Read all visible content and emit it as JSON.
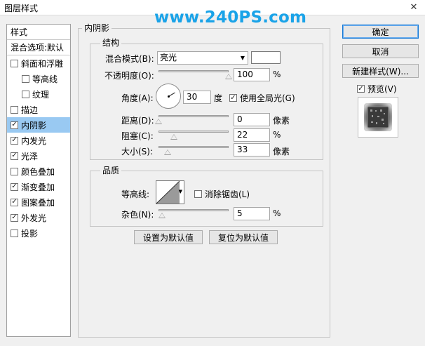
{
  "window": {
    "title": "图层样式",
    "close_glyph": "✕"
  },
  "watermark": "www.240PS.com",
  "sidebar": {
    "header_style": "样式",
    "header_blend": "混合选项:默认",
    "items": [
      {
        "label": "斜面和浮雕",
        "checked": false
      },
      {
        "label": "等高线",
        "checked": false,
        "indent": true
      },
      {
        "label": "纹理",
        "checked": false,
        "indent": true
      },
      {
        "label": "描边",
        "checked": false
      },
      {
        "label": "内阴影",
        "checked": true,
        "active": true
      },
      {
        "label": "内发光",
        "checked": true
      },
      {
        "label": "光泽",
        "checked": true
      },
      {
        "label": "颜色叠加",
        "checked": false
      },
      {
        "label": "渐变叠加",
        "checked": true
      },
      {
        "label": "图案叠加",
        "checked": true
      },
      {
        "label": "外发光",
        "checked": true
      },
      {
        "label": "投影",
        "checked": false
      }
    ]
  },
  "panel": {
    "title": "内阴影",
    "structure": {
      "title": "结构",
      "blend_mode_label": "混合模式(B):",
      "blend_mode_value": "亮光",
      "blend_color": "#ffffff",
      "opacity_label": "不透明度(O):",
      "opacity_value": "100",
      "opacity_unit": "%",
      "angle_label": "角度(A):",
      "angle_value": "30",
      "angle_unit": "度",
      "global_light_label": "使用全局光(G)",
      "global_light_checked": true,
      "distance_label": "距离(D):",
      "distance_value": "0",
      "distance_unit": "像素",
      "choke_label": "阻塞(C):",
      "choke_value": "22",
      "choke_unit": "%",
      "size_label": "大小(S):",
      "size_value": "33",
      "size_unit": "像素"
    },
    "quality": {
      "title": "品质",
      "contour_label": "等高线:",
      "antialias_label": "消除锯齿(L)",
      "antialias_checked": false,
      "noise_label": "杂色(N):",
      "noise_value": "5",
      "noise_unit": "%"
    },
    "set_default_label": "设置为默认值",
    "reset_default_label": "复位为默认值"
  },
  "actions": {
    "ok_label": "确定",
    "cancel_label": "取消",
    "new_style_label": "新建样式(W)...",
    "preview_label": "预览(V)",
    "preview_checked": true
  },
  "sliders": {
    "opacity": 1.0,
    "distance": 0.0,
    "choke": 0.22,
    "size": 0.13,
    "noise": 0.05
  },
  "icons": {
    "check": "check-icon",
    "close": "close-icon",
    "dropdown": "chevron-down-icon"
  },
  "colors": {
    "accent": "#1478d4",
    "active_row": "#99c9f2",
    "watermark": "#1aa3e8"
  }
}
